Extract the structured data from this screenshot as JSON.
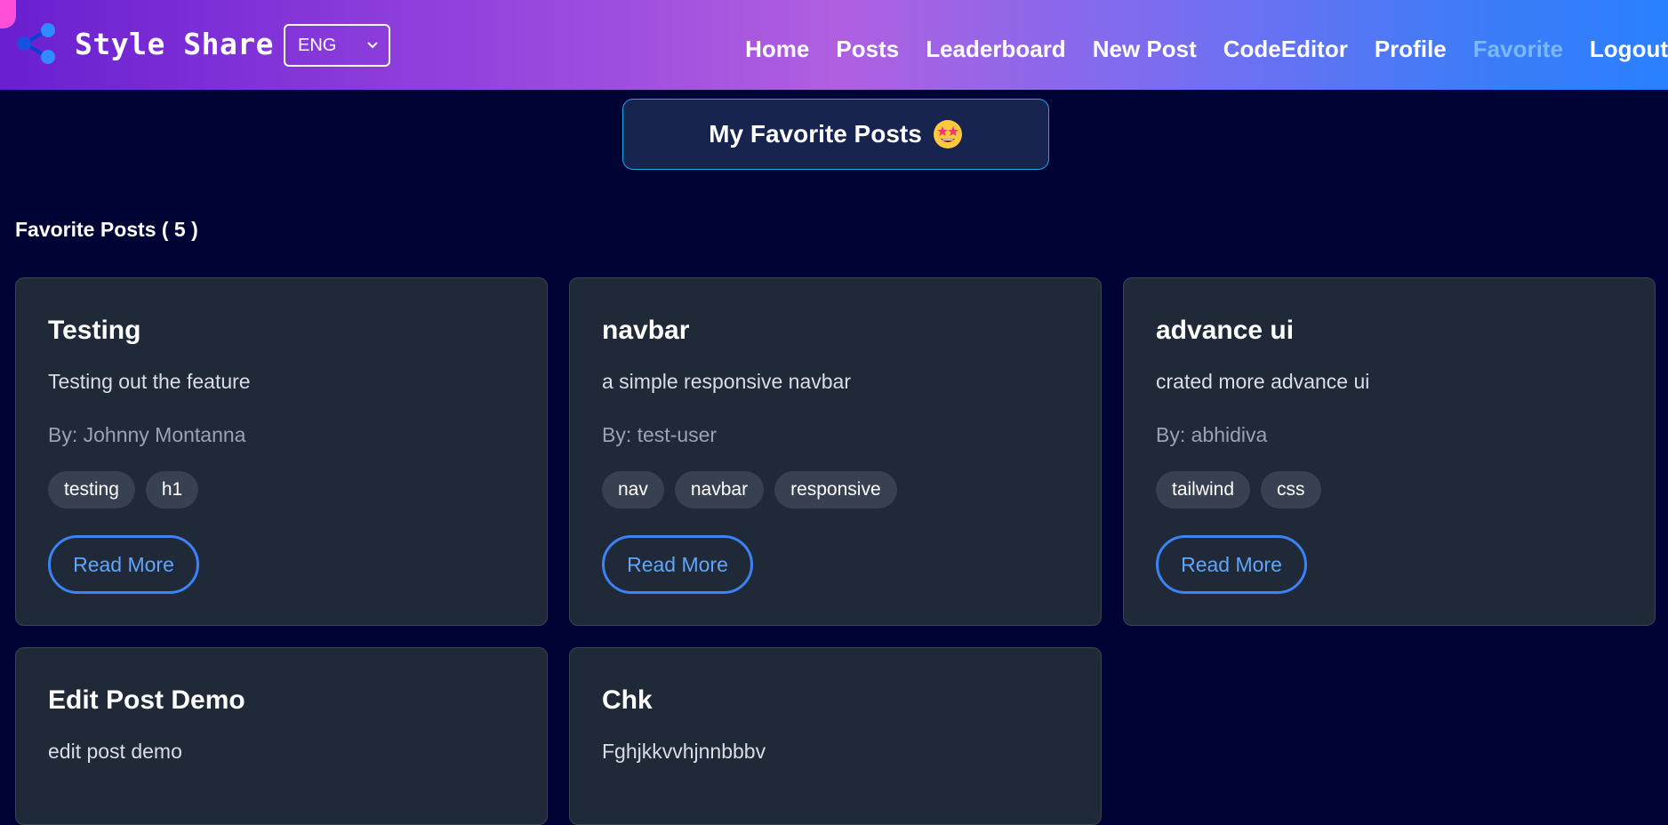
{
  "brand": {
    "title": "Style Share",
    "icon": "share-icon"
  },
  "language": {
    "selected": "ENG"
  },
  "nav": {
    "links": [
      {
        "label": "Home"
      },
      {
        "label": "Posts"
      },
      {
        "label": "Leaderboard"
      },
      {
        "label": "New Post"
      },
      {
        "label": "CodeEditor"
      },
      {
        "label": "Profile"
      },
      {
        "label": "Favorite",
        "active": true
      },
      {
        "label": "Logout"
      }
    ]
  },
  "page": {
    "heading": "My Favorite Posts",
    "heading_emoji": "star-struck-emoji",
    "count_label": "Favorite Posts ( 5 )"
  },
  "cards": [
    {
      "title": "Testing",
      "description": "Testing out the feature",
      "author": "By: Johnny Montanna",
      "tags": [
        "testing",
        "h1"
      ],
      "button": "Read More"
    },
    {
      "title": "navbar",
      "description": "a simple responsive navbar",
      "author": "By: test-user",
      "tags": [
        "nav",
        "navbar",
        "responsive"
      ],
      "button": "Read More"
    },
    {
      "title": "advance ui",
      "description": "crated more advance ui",
      "author": "By: abhidiva",
      "tags": [
        "tailwind",
        "css"
      ],
      "button": "Read More"
    },
    {
      "title": "Edit Post Demo",
      "description": "edit post demo"
    },
    {
      "title": "Chk",
      "description": "Fghjkkvvhjnnbbbv"
    }
  ],
  "colors": {
    "background": "#000435",
    "card": "#1f2937",
    "accent": "#3b82f6",
    "active_nav": "#7ab8ff"
  }
}
